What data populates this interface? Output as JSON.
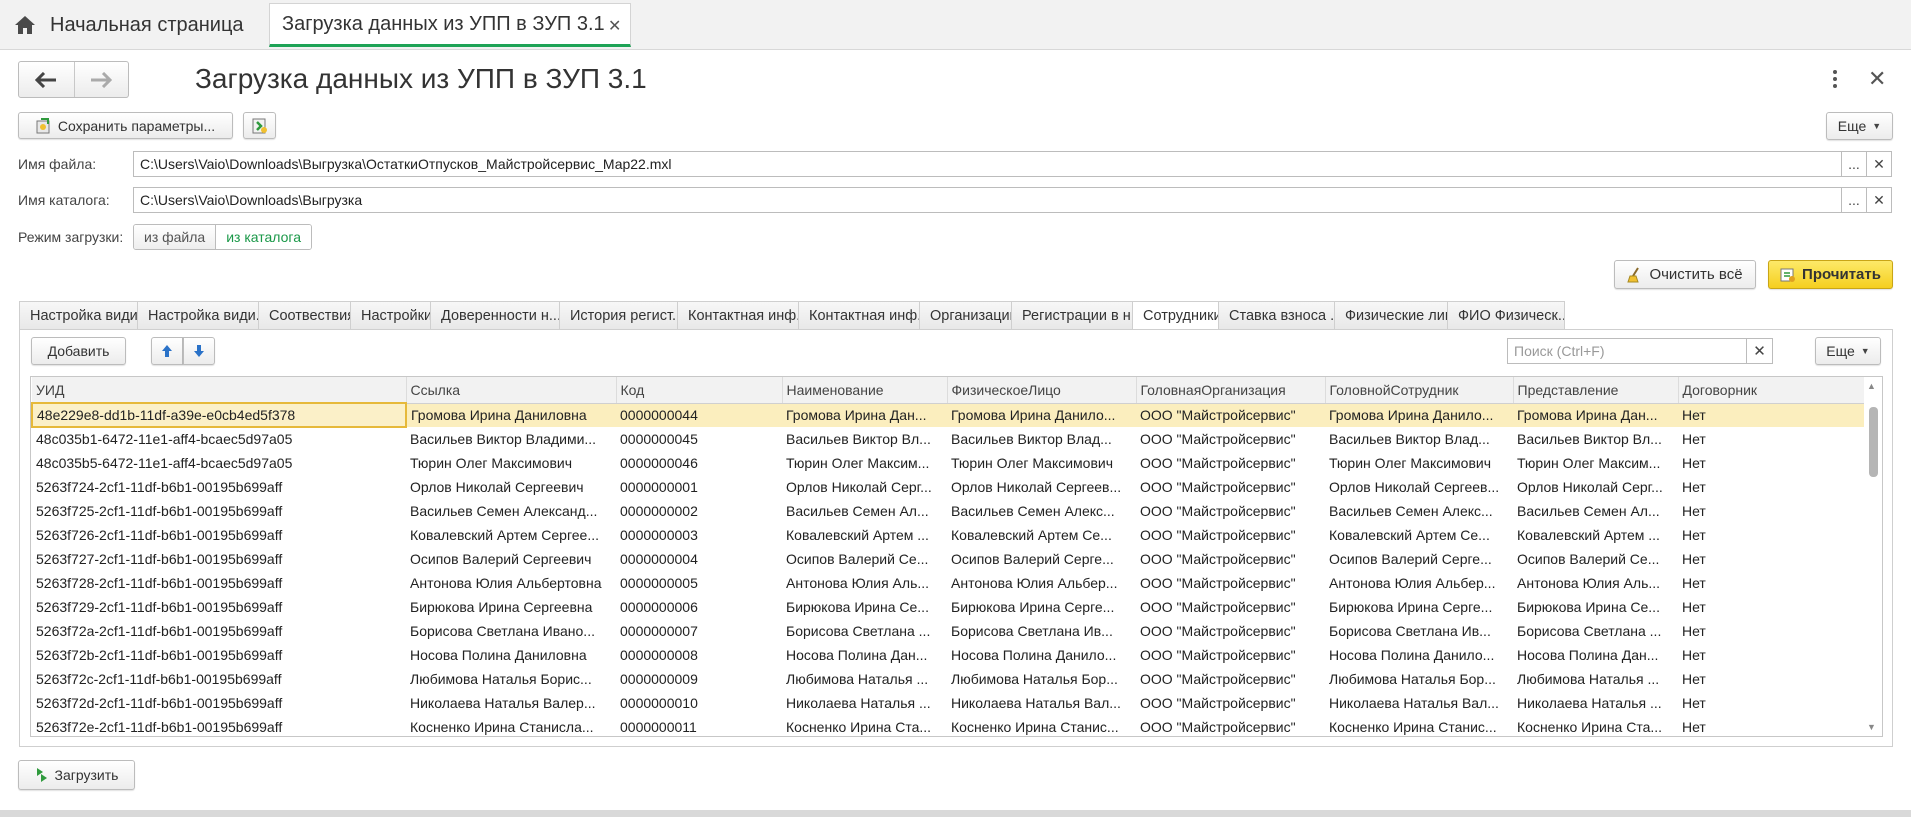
{
  "top_tabs": {
    "home_label": "Начальная страница",
    "active_label": "Загрузка данных из УПП в ЗУП 3.1",
    "close_glyph": "✕"
  },
  "header": {
    "title": "Загрузка данных из УПП в ЗУП 3.1",
    "back_icon": "arrow-left-icon",
    "forward_icon": "arrow-right-icon",
    "close_glyph": "✕"
  },
  "toolbar": {
    "save_label": "Сохранить параметры...",
    "more_label": "Еще"
  },
  "form": {
    "file_label": "Имя файла:",
    "file_value": "C:\\Users\\Vaio\\Downloads\\Выгрузка\\ОстаткиОтпусков_Майстройсервис_Мар22.mxl",
    "catalog_label": "Имя каталога:",
    "catalog_value": "C:\\Users\\Vaio\\Downloads\\Выгрузка",
    "select_glyph": "...",
    "clear_glyph": "✕",
    "mode_label": "Режим загрузки:",
    "mode_options": [
      "из файла",
      "из каталога"
    ],
    "mode_selected": "из каталога"
  },
  "actions": {
    "clear_all_label": "Очистить всё",
    "read_label": "Прочитать",
    "upload_label": "Загрузить"
  },
  "tabs": [
    "Настройка види...",
    "Настройка види...",
    "Соотвествия",
    "Настройки",
    "Доверенности н...",
    "История регист...",
    "Контактная инф...",
    "Контактная инф...",
    "Организации",
    "Регистрации в н...",
    "Сотрудники",
    "Ставка взноса ...",
    "Физические лица",
    "ФИО Физическ..."
  ],
  "selected_tab": "Сотрудники",
  "tab_toolbar": {
    "add_label": "Добавить",
    "search_placeholder": "Поиск (Ctrl+F)",
    "search_clear_glyph": "✕",
    "more_label": "Еще"
  },
  "colors": {
    "accent_green": "#1ea356",
    "read_button_yellow": "#f8d93c",
    "selected_row": "#fbeebe"
  },
  "table": {
    "columns": [
      "УИД",
      "Ссылка",
      "Код",
      "Наименование",
      "ФизическоеЛицо",
      "ГоловнаяОрганизация",
      "ГоловнойСотрудник",
      "Представление",
      "Договорник"
    ],
    "selected_row": 0,
    "rows": [
      [
        "48e229e8-dd1b-11df-a39e-e0cb4ed5f378",
        "Громова Ирина Даниловна",
        "0000000044",
        "Громова Ирина Дан...",
        "Громова Ирина Данило...",
        "ООО \"Майстройсервис\"",
        "Громова Ирина Данило...",
        "Громова Ирина Дан...",
        "Нет"
      ],
      [
        "48c035b1-6472-11e1-aff4-bcaec5d97a05",
        "Васильев Виктор Владими...",
        "0000000045",
        "Васильев Виктор Вл...",
        "Васильев Виктор Влад...",
        "ООО \"Майстройсервис\"",
        "Васильев Виктор Влад...",
        "Васильев Виктор Вл...",
        "Нет"
      ],
      [
        "48c035b5-6472-11e1-aff4-bcaec5d97a05",
        "Тюрин Олег Максимович",
        "0000000046",
        "Тюрин Олег Максим...",
        "Тюрин Олег Максимович",
        "ООО \"Майстройсервис\"",
        "Тюрин Олег Максимович",
        "Тюрин Олег Максим...",
        "Нет"
      ],
      [
        "5263f724-2cf1-11df-b6b1-00195b699aff",
        "Орлов Николай Сергеевич",
        "0000000001",
        "Орлов Николай Серг...",
        "Орлов Николай Сергеев...",
        "ООО \"Майстройсервис\"",
        "Орлов Николай Сергеев...",
        "Орлов Николай Серг...",
        "Нет"
      ],
      [
        "5263f725-2cf1-11df-b6b1-00195b699aff",
        "Васильев Семен Александ...",
        "0000000002",
        "Васильев Семен Ал...",
        "Васильев Семен Алекс...",
        "ООО \"Майстройсервис\"",
        "Васильев Семен Алекс...",
        "Васильев Семен Ал...",
        "Нет"
      ],
      [
        "5263f726-2cf1-11df-b6b1-00195b699aff",
        "Ковалевский Артем Сергее...",
        "0000000003",
        "Ковалевский Артем ...",
        "Ковалевский Артем Се...",
        "ООО \"Майстройсервис\"",
        "Ковалевский Артем Се...",
        "Ковалевский Артем ...",
        "Нет"
      ],
      [
        "5263f727-2cf1-11df-b6b1-00195b699aff",
        "Осипов Валерий Сергеевич",
        "0000000004",
        "Осипов Валерий Се...",
        "Осипов Валерий Серге...",
        "ООО \"Майстройсервис\"",
        "Осипов Валерий Серге...",
        "Осипов Валерий Се...",
        "Нет"
      ],
      [
        "5263f728-2cf1-11df-b6b1-00195b699aff",
        "Антонова Юлия Альбертовна",
        "0000000005",
        "Антонова Юлия Аль...",
        "Антонова Юлия Альбер...",
        "ООО \"Майстройсервис\"",
        "Антонова Юлия Альбер...",
        "Антонова Юлия Аль...",
        "Нет"
      ],
      [
        "5263f729-2cf1-11df-b6b1-00195b699aff",
        "Бирюкова Ирина Сергеевна",
        "0000000006",
        "Бирюкова Ирина Се...",
        "Бирюкова Ирина Серге...",
        "ООО \"Майстройсервис\"",
        "Бирюкова Ирина Серге...",
        "Бирюкова Ирина Се...",
        "Нет"
      ],
      [
        "5263f72a-2cf1-11df-b6b1-00195b699aff",
        "Борисова Светлана Ивано...",
        "0000000007",
        "Борисова Светлана ...",
        "Борисова Светлана Ив...",
        "ООО \"Майстройсервис\"",
        "Борисова Светлана Ив...",
        "Борисова Светлана ...",
        "Нет"
      ],
      [
        "5263f72b-2cf1-11df-b6b1-00195b699aff",
        "Носова Полина Даниловна",
        "0000000008",
        "Носова Полина Дан...",
        "Носова Полина Данило...",
        "ООО \"Майстройсервис\"",
        "Носова Полина Данило...",
        "Носова Полина Дан...",
        "Нет"
      ],
      [
        "5263f72c-2cf1-11df-b6b1-00195b699aff",
        "Любимова Наталья Борис...",
        "0000000009",
        "Любимова Наталья ...",
        "Любимова Наталья Бор...",
        "ООО \"Майстройсервис\"",
        "Любимова Наталья Бор...",
        "Любимова Наталья ...",
        "Нет"
      ],
      [
        "5263f72d-2cf1-11df-b6b1-00195b699aff",
        "Николаева Наталья Валер...",
        "0000000010",
        "Николаева Наталья ...",
        "Николаева Наталья Вал...",
        "ООО \"Майстройсервис\"",
        "Николаева Наталья Вал...",
        "Николаева Наталья ...",
        "Нет"
      ],
      [
        "5263f72e-2cf1-11df-b6b1-00195b699aff",
        "Косненко Ирина Станисла...",
        "0000000011",
        "Косненко Ирина Ста...",
        "Косненко Ирина Станис...",
        "ООО \"Майстройсервис\"",
        "Косненко Ирина Станис...",
        "Косненко Ирина Ста...",
        "Нет"
      ]
    ]
  }
}
